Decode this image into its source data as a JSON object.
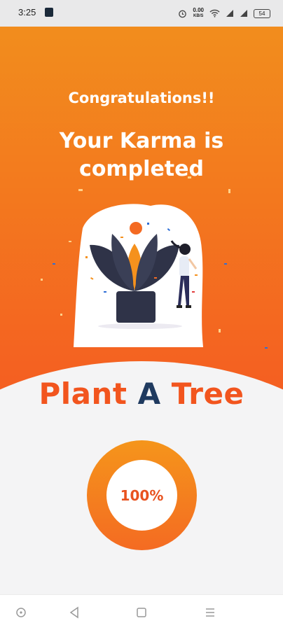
{
  "status_bar": {
    "time": "3:25",
    "net_speed": "0.00",
    "net_unit": "KB/S",
    "battery": "54"
  },
  "hero": {
    "congrats": "Congratulations!!",
    "karma_line1": "Your Karma is",
    "karma_line2": "completed"
  },
  "main": {
    "title_part1": "Plant ",
    "title_part2": "A",
    "title_part3": " Tree",
    "progress_label": "100%",
    "progress_value": 1.0
  },
  "colors": {
    "orange_top": "#f28d1d",
    "orange_bottom": "#f45b22",
    "title_orange": "#f2551e",
    "title_navy": "#1f3a5f"
  },
  "nav": {
    "icons": [
      "home-circle-icon",
      "back-icon",
      "recent-apps-icon",
      "menu-icon"
    ]
  }
}
